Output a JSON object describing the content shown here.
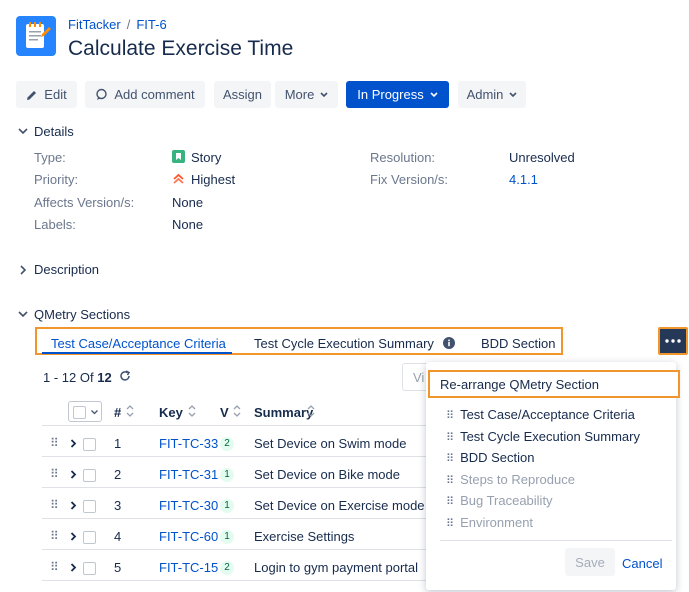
{
  "header": {
    "project": "FitTacker",
    "separator": "/",
    "issue_key": "FIT-6",
    "title": "Calculate Exercise Time"
  },
  "toolbar": {
    "edit": "Edit",
    "add_comment": "Add comment",
    "assign": "Assign",
    "more": "More",
    "status": "In Progress",
    "admin": "Admin"
  },
  "details": {
    "heading": "Details",
    "type_label": "Type:",
    "type_value": "Story",
    "priority_label": "Priority:",
    "priority_value": "Highest",
    "affects_label": "Affects Version/s:",
    "affects_value": "None",
    "labels_label": "Labels:",
    "labels_value": "None",
    "resolution_label": "Resolution:",
    "resolution_value": "Unresolved",
    "fixversion_label": "Fix Version/s:",
    "fixversion_value": "4.1.1"
  },
  "description": {
    "heading": "Description"
  },
  "qmetry": {
    "heading": "QMetry Sections",
    "tabs": [
      "Test Case/Acceptance Criteria",
      "Test Cycle Execution Summary",
      "BDD Section"
    ],
    "pagination": {
      "range": "1 - 12",
      "of": "Of",
      "total": "12"
    },
    "search_placeholder": "Vi",
    "columns": {
      "num": "#",
      "key": "Key",
      "v": "V",
      "summary": "Summary"
    },
    "rows": [
      {
        "num": "1",
        "key": "FIT-TC-33",
        "v": "2",
        "summary": "Set Device on Swim mode"
      },
      {
        "num": "2",
        "key": "FIT-TC-31",
        "v": "1",
        "summary": "Set Device on Bike mode"
      },
      {
        "num": "3",
        "key": "FIT-TC-30",
        "v": "1",
        "summary": "Set Device on Exercise mode"
      },
      {
        "num": "4",
        "key": "FIT-TC-60",
        "v": "1",
        "summary": "Exercise Settings"
      },
      {
        "num": "5",
        "key": "FIT-TC-15",
        "v": "2",
        "summary": "Login to gym payment portal"
      }
    ]
  },
  "popup": {
    "title": "Re-arrange QMetry Section",
    "items": [
      "Test Case/Acceptance Criteria",
      "Test Cycle Execution Summary",
      "BDD Section",
      "Steps to Reproduce",
      "Bug Traceability",
      "Environment"
    ],
    "save": "Save",
    "cancel": "Cancel"
  },
  "colors": {
    "brand": "#0052cc",
    "highlight": "#f0962d",
    "status_btn": "#0052cc",
    "story": "#36b37e",
    "priority": "#ff5630"
  }
}
